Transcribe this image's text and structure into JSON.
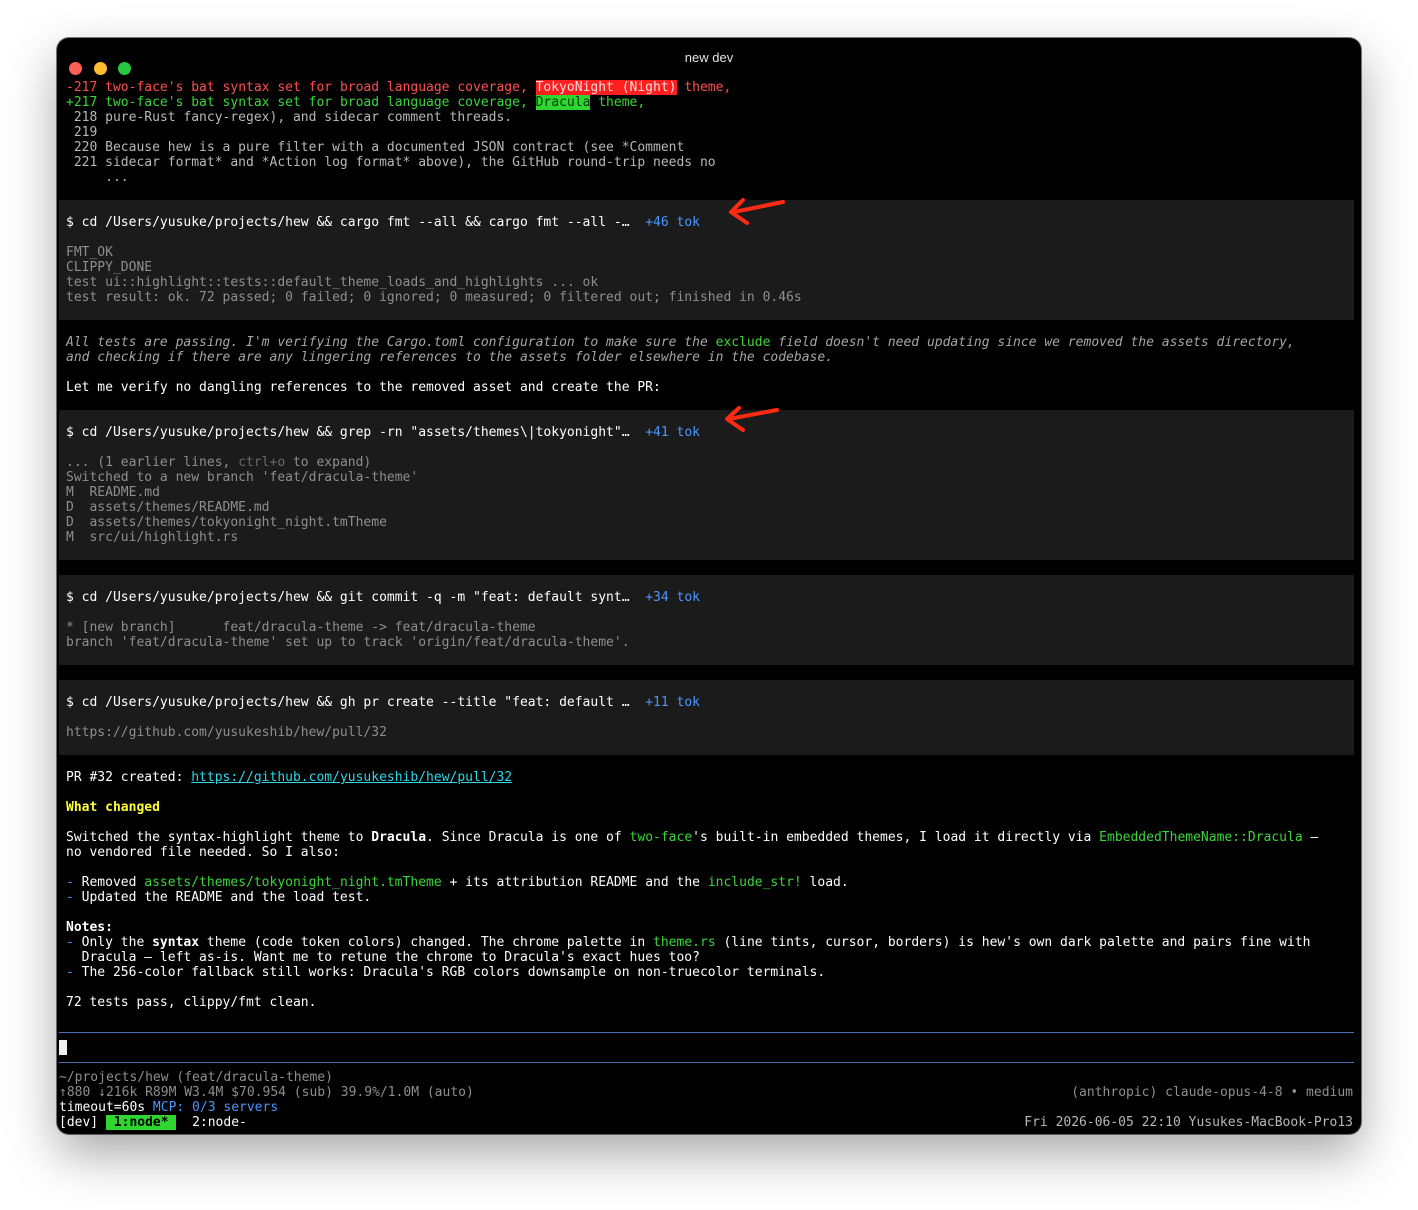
{
  "window": {
    "title": "new dev"
  },
  "diff": {
    "removed_num": "-217",
    "removed_pre": " two-face's bat syntax set for broad language coverage, ",
    "removed_hl": "TokyoNight (Night)",
    "removed_post": " theme,",
    "added_num": "+217",
    "added_pre": " two-face's bat syntax set for broad language coverage, ",
    "added_hl": "Dracula",
    "added_post": " theme,",
    "lines": [
      " 218 pure-Rust fancy-regex), and sidecar comment threads.",
      " 219",
      " 220 Because hew is a pure filter with a documented JSON contract (see *Comment",
      " 221 sidecar format* and *Action log format* above), the GitHub round-trip needs no",
      "     ..."
    ]
  },
  "block1": {
    "cmd": "$ cd /Users/yusuke/projects/hew && cargo fmt --all && cargo fmt --all -…",
    "tok": "+46 tok",
    "output": [
      "FMT_OK",
      "CLIPPY_DONE",
      "test ui::highlight::tests::default_theme_loads_and_highlights ... ok",
      "test result: ok. 72 passed; 0 failed; 0 ignored; 0 measured; 0 filtered out; finished in 0.46s"
    ]
  },
  "thinking": {
    "l1_a": "All tests are passing. I'm verifying the Cargo.toml configuration to make sure the ",
    "l1_code": "exclude",
    "l1_b": " field doesn't need updating since we removed the assets directory,",
    "l2": "and checking if there are any lingering references to the assets folder elsewhere in the codebase."
  },
  "verify_text": "Let me verify no dangling references to the removed asset and create the PR:",
  "block2": {
    "cmd": "$ cd /Users/yusuke/projects/hew && grep -rn \"assets/themes\\|tokyonight\"…",
    "tok": "+41 tok",
    "expand_a": "... (1 earlier lines, ",
    "expand_key": "ctrl+o",
    "expand_b": " to expand)",
    "output": [
      "Switched to a new branch 'feat/dracula-theme'",
      "M  README.md",
      "D  assets/themes/README.md",
      "D  assets/themes/tokyonight_night.tmTheme",
      "M  src/ui/highlight.rs"
    ]
  },
  "block3": {
    "cmd": "$ cd /Users/yusuke/projects/hew && git commit -q -m \"feat: default synt…",
    "tok": "+34 tok",
    "output": [
      "* [new branch]      feat/dracula-theme -> feat/dracula-theme",
      "branch 'feat/dracula-theme' set up to track 'origin/feat/dracula-theme'."
    ]
  },
  "block4": {
    "cmd": "$ cd /Users/yusuke/projects/hew && gh pr create --title \"feat: default …",
    "tok": "+11 tok",
    "output": [
      "https://github.com/yusukeshib/hew/pull/32"
    ]
  },
  "summary": {
    "pr_label": "PR #32 created: ",
    "pr_url": "https://github.com/yusukeshib/hew/pull/32",
    "what_changed": "What changed",
    "p1_a": "Switched the syntax-highlight theme to ",
    "p1_bold": "Dracula",
    "p1_b": ". Since Dracula is one of ",
    "p1_code1": "two-face",
    "p1_c": "'s built-in embedded themes, I load it directly via ",
    "p1_code2": "EmbeddedThemeName::Dracula",
    "p1_d": " —",
    "p1_l2": "no vendored file needed. So I also:",
    "b1_dash": "- ",
    "b1_a": "Removed ",
    "b1_code": "assets/themes/tokyonight_night.tmTheme",
    "b1_b": " + its attribution README and the ",
    "b1_code2": "include_str!",
    "b1_c": " load.",
    "b2_dash": "- ",
    "b2": "Updated the README and the load test.",
    "notes": "Notes:",
    "n1_dash": "- ",
    "n1_a": "Only the ",
    "n1_bold": "syntax",
    "n1_b": " theme (code token colors) changed. The chrome palette in ",
    "n1_code": "theme.rs",
    "n1_c": " (line tints, cursor, borders) is hew's own dark palette and pairs fine with",
    "n1_l2": "  Dracula — left as-is. Want me to retune the chrome to Dracula's exact hues too?",
    "n2_dash": "- ",
    "n2": "The 256-color fallback still works: Dracula's RGB colors downsample on non-truecolor terminals.",
    "final": "72 tests pass, clippy/fmt clean."
  },
  "status": {
    "cwd": "~/projects/hew (feat/dracula-theme)",
    "stats": "↑880 ↓216k R89M W3.4M $70.954 (sub) 39.9%/1.0M (auto)",
    "model": "(anthropic) claude-opus-4-8 • medium",
    "timeout": "timeout=60s ",
    "mcp_label": "MCP:",
    "mcp_value": " 0/3 servers",
    "session": "[dev] ",
    "tab1": " 1:node* ",
    "tab2": "  2:node-",
    "clock": "Fri 2026-06-05 22:10 Yusukes-MacBook-Pro13"
  },
  "colors": {
    "annotation_arrow": "#ff2a12",
    "added": "#3bd43b",
    "removed": "#ff4f4f",
    "token_count": "#4a96ff",
    "separator": "#4a6fb8"
  }
}
